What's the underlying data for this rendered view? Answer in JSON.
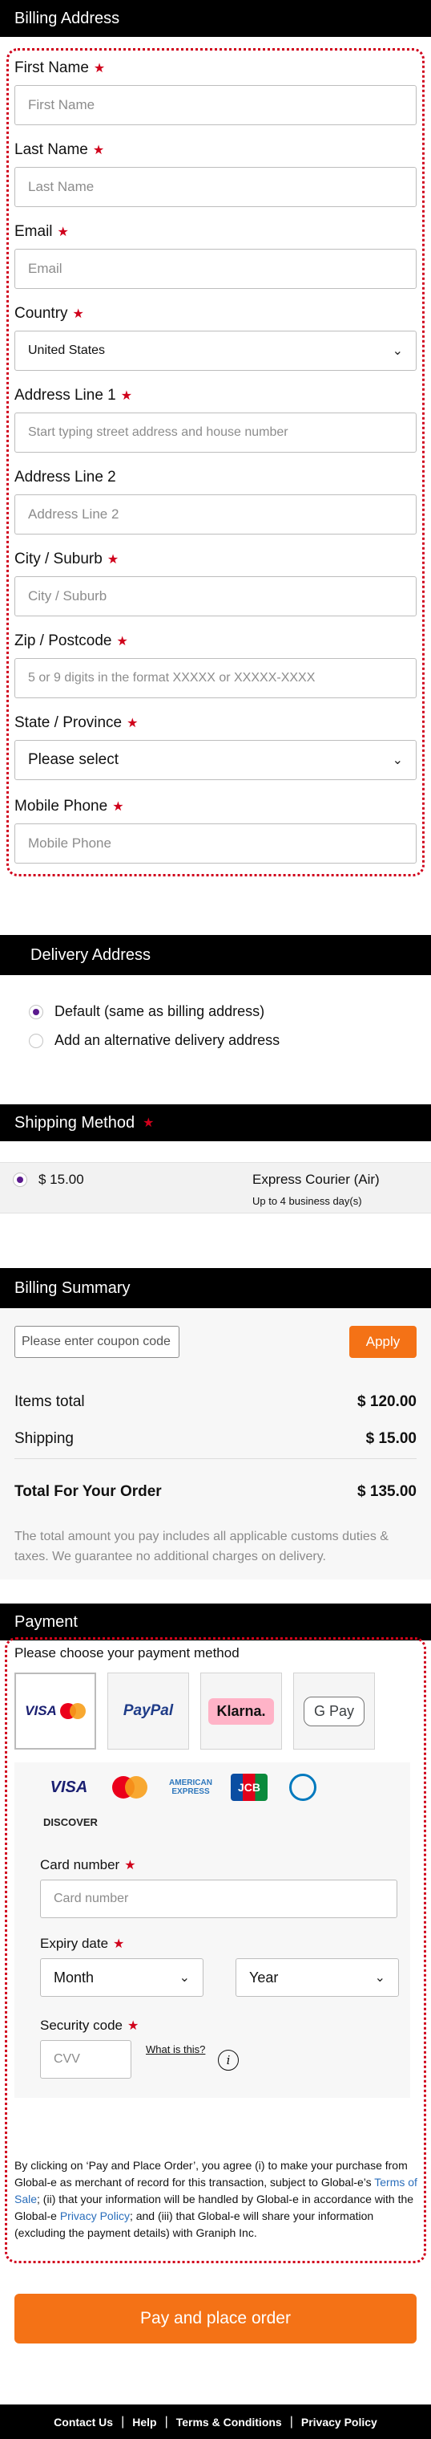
{
  "billing": {
    "title": "Billing Address",
    "first_name": {
      "label": "First Name",
      "placeholder": "First Name"
    },
    "last_name": {
      "label": "Last Name",
      "placeholder": "Last Name"
    },
    "email": {
      "label": "Email",
      "placeholder": "Email"
    },
    "country": {
      "label": "Country",
      "value": "United States"
    },
    "address1": {
      "label": "Address Line 1",
      "placeholder": "Start typing street address and house number"
    },
    "address2": {
      "label": "Address Line 2",
      "placeholder": "Address Line 2"
    },
    "city": {
      "label": "City / Suburb",
      "placeholder": "City / Suburb"
    },
    "zip": {
      "label": "Zip / Postcode",
      "placeholder": "5 or 9 digits in the format XXXXX or XXXXX-XXXX"
    },
    "state": {
      "label": "State / Province",
      "value": "Please select"
    },
    "mobile": {
      "label": "Mobile Phone",
      "placeholder": "Mobile Phone"
    },
    "required_mark": "★"
  },
  "delivery": {
    "title": "Delivery Address",
    "option_default": "Default (same as billing address)",
    "option_alternative": "Add an alternative delivery address"
  },
  "shipping": {
    "title": "Shipping Method",
    "price": "$ 15.00",
    "method": "Express Courier (Air)",
    "eta": "Up to 4 business day(s)"
  },
  "summary": {
    "title": "Billing Summary",
    "coupon_placeholder": "Please enter coupon code",
    "apply": "Apply",
    "items_label": "Items total",
    "items_value": "$ 120.00",
    "shipping_label": "Shipping",
    "shipping_value": "$ 15.00",
    "total_label": "Total For Your Order",
    "total_value": "$ 135.00",
    "note": "The total amount you pay includes all applicable customs duties & taxes. We guarantee no additional charges on delivery."
  },
  "payment": {
    "title": "Payment",
    "choose": "Please choose your payment method",
    "methods": {
      "visa": "VISA",
      "paypal": "PayPal",
      "klarna": "Klarna.",
      "gpay": "G Pay"
    },
    "brands": {
      "visa": "VISA",
      "amex": "AMERICAN EXPRESS",
      "jcb": "JCB",
      "discover": "DISCOVER"
    },
    "card_number_label": "Card number",
    "card_number_placeholder": "Card number",
    "expiry_label": "Expiry date",
    "month": "Month",
    "year": "Year",
    "cvv_label": "Security code",
    "cvv_placeholder": "CVV",
    "what_is_this": "What is this?",
    "info_glyph": "i",
    "legal": {
      "p1": "By clicking on ‘Pay and Place Order’, you agree (i) to make your purchase from Global-e as merchant of record for this transaction, subject to Global-e’s ",
      "terms_link": "Terms of Sale",
      "p2": "; (ii) that your information will be handled by Global-e in accordance with the Global-e ",
      "privacy_link": "Privacy Policy",
      "p3": "; and (iii) that Global-e will share your information (excluding the payment details) with Graniph Inc."
    }
  },
  "pay_button": "Pay and place order",
  "footer": {
    "contact": "Contact Us",
    "help": "Help",
    "terms": "Terms & Conditions",
    "privacy": "Privacy Policy",
    "sep": "|"
  },
  "colors": {
    "accent": "#f47216",
    "required": "#d0011b",
    "radio": "#5b1a8e",
    "link": "#2a6ebb"
  }
}
